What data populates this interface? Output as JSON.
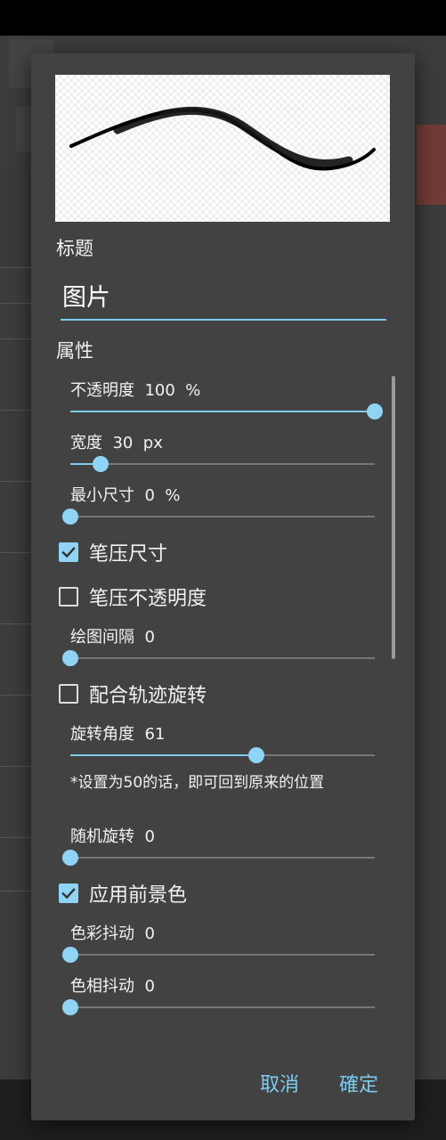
{
  "dialog": {
    "title_section_label": "标题",
    "title_value": "图片",
    "properties_label": "属性",
    "sliders": [
      {
        "label": "不透明度  100  %",
        "value": 1.0
      },
      {
        "label": "宽度  30  px",
        "value": 0.1
      },
      {
        "label": "最小尺寸  0  %",
        "value": 0.0
      },
      {
        "label": "绘图间隔  0",
        "value": 0.0
      },
      {
        "label": "旋转角度  61",
        "value": 0.61
      },
      {
        "label": "随机旋转  0",
        "value": 0.0
      },
      {
        "label": "色彩抖动  0",
        "value": 0.0
      },
      {
        "label": "色相抖动  0",
        "value": 0.0
      }
    ],
    "checkboxes": [
      {
        "label": "笔压尺寸",
        "checked": true
      },
      {
        "label": "笔压不透明度",
        "checked": false
      },
      {
        "label": "配合轨迹旋转",
        "checked": false
      },
      {
        "label": "应用前景色",
        "checked": true
      }
    ],
    "rotation_note": "*设置为50的话，即可回到原来的位置",
    "cancel_label": "取消",
    "confirm_label": "確定"
  },
  "colors": {
    "accent": "#7ecbf0",
    "dialog_bg": "#424242",
    "thumb": "#8fd3f5"
  }
}
